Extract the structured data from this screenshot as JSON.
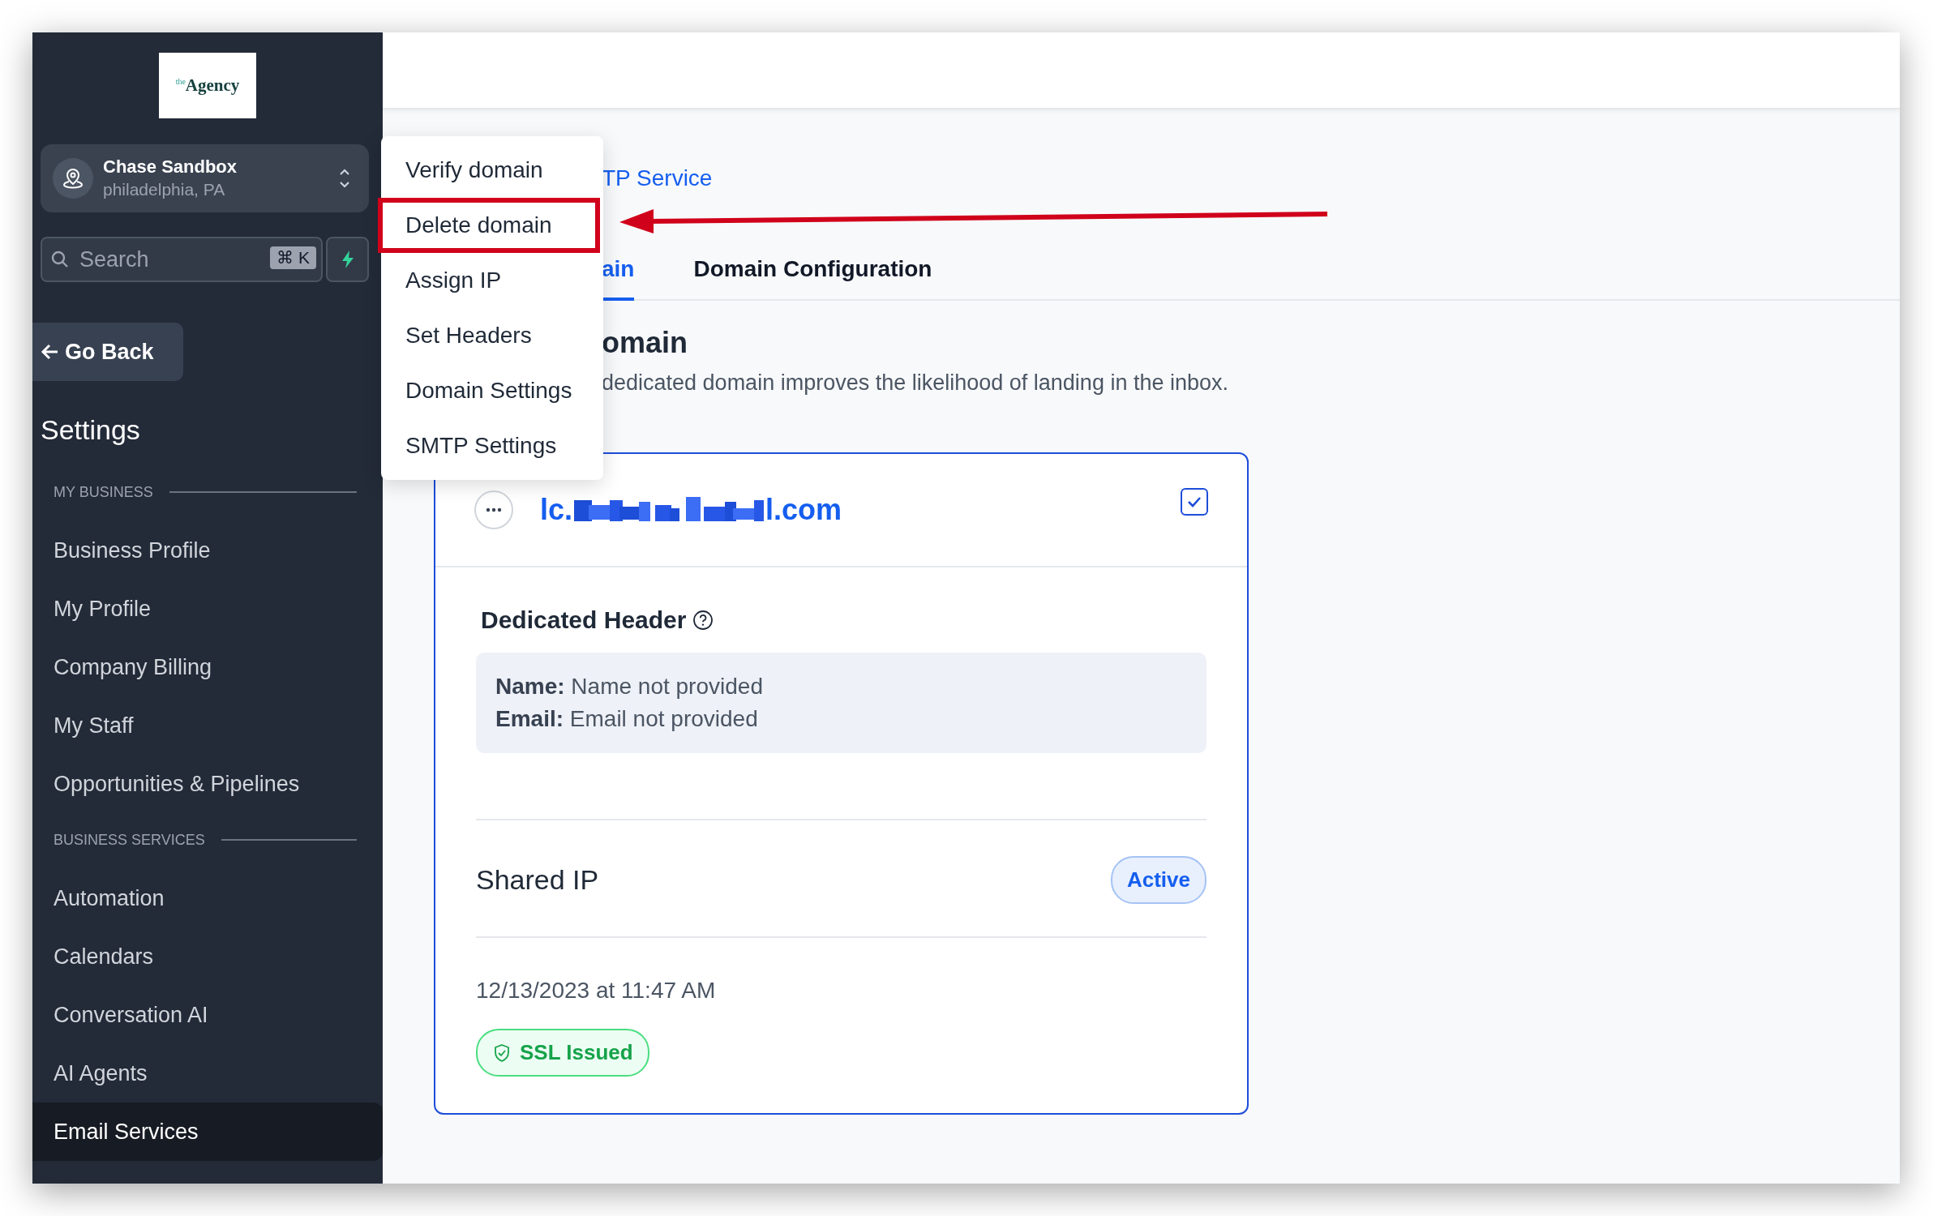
{
  "sidebar": {
    "logo": {
      "prefix": "the",
      "name": "Agency"
    },
    "location": {
      "name": "Chase Sandbox",
      "place": "philadelphia, PA"
    },
    "search": {
      "placeholder": "Search",
      "shortcut": "⌘ K"
    },
    "back_button": "Go Back",
    "title": "Settings",
    "sections": [
      {
        "heading": "MY BUSINESS",
        "items": [
          {
            "label": "Business Profile",
            "selected": false
          },
          {
            "label": "My Profile",
            "selected": false
          },
          {
            "label": "Company Billing",
            "selected": false
          },
          {
            "label": "My Staff",
            "selected": false
          },
          {
            "label": "Opportunities & Pipelines",
            "selected": false
          }
        ]
      },
      {
        "heading": "BUSINESS SERVICES",
        "items": [
          {
            "label": "Automation",
            "selected": false
          },
          {
            "label": "Calendars",
            "selected": false
          },
          {
            "label": "Conversation AI",
            "selected": false
          },
          {
            "label": "AI Agents",
            "selected": false
          },
          {
            "label": "Email Services",
            "selected": true
          }
        ]
      }
    ]
  },
  "breadcrumb": "TP Service",
  "tabs": [
    {
      "label": "ain",
      "selected": true
    },
    {
      "label": "Domain Configuration",
      "selected": false
    }
  ],
  "section": {
    "title": "omain",
    "description": "dedicated domain improves the likelihood of landing in the inbox."
  },
  "domain_card": {
    "domain_start": "lc.",
    "domain_end": "l.com",
    "checked": true,
    "header_title": "Dedicated Header",
    "header_fields": [
      {
        "label": "Name:",
        "value": "Name not provided"
      },
      {
        "label": "Email:",
        "value": "Email not provided"
      }
    ],
    "ip_label": "Shared IP",
    "ip_status": "Active",
    "created": "12/13/2023 at 11:47 AM",
    "ssl_status": "SSL Issued"
  },
  "menu": {
    "items": [
      {
        "label": "Verify domain",
        "highlighted": false
      },
      {
        "label": "Delete domain",
        "highlighted": true
      },
      {
        "label": "Assign IP",
        "highlighted": false
      },
      {
        "label": "Set Headers",
        "highlighted": false
      },
      {
        "label": "Domain Settings",
        "highlighted": false
      },
      {
        "label": "SMTP Settings",
        "highlighted": false
      }
    ]
  }
}
